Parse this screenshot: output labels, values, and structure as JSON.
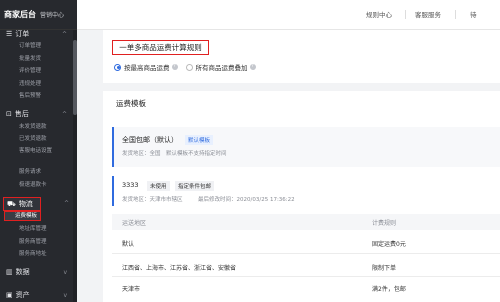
{
  "brand": {
    "title": "商家后台",
    "subtitle": "营销中心"
  },
  "topbar": {
    "links": [
      "规则中心",
      "客服服务",
      "待"
    ]
  },
  "sidebar": {
    "groups": [
      {
        "label": "订单",
        "items": [
          "订单管理",
          "批量发货",
          "评价管理",
          "违规处理",
          "售后预警"
        ]
      },
      {
        "label": "售后",
        "items": [
          "未发货退款",
          "已发货退款",
          "客服电话设置",
          "服务请求",
          "极速退款卡"
        ]
      },
      {
        "label": "物流",
        "items": [
          "运费模板",
          "地址库管理",
          "服务商管理",
          "服务商地址"
        ]
      },
      {
        "label": "数据",
        "items": []
      },
      {
        "label": "资产",
        "items": []
      }
    ]
  },
  "main": {
    "title": "一单多商品运费计算规则",
    "options": [
      {
        "label": "按最高商品运费",
        "selected": true
      },
      {
        "label": "所有商品运费叠加",
        "selected": false
      }
    ],
    "section_title": "运费模板",
    "template1": {
      "name": "全国包邮（默认）",
      "badge": "默认模板",
      "area": "发货地区：全国　默认模板不支持指定时间"
    },
    "template2": {
      "name": "3333",
      "tags": [
        "未使用",
        "指定条件包邮"
      ],
      "area": "发货地区：天津市市辖区",
      "time": "最后修改时间：2020/03/25 17:36:22"
    },
    "table": {
      "headers": [
        "运送地区",
        "计费规则"
      ],
      "rows": [
        {
          "region": "默认",
          "rule": "固定运费0元"
        },
        {
          "region": "江西省、上海市、江苏省、浙江省、安徽省",
          "rule": "限制下单"
        },
        {
          "region": "天津市",
          "rule": "满2件，包邮"
        }
      ]
    }
  },
  "colors": {
    "accent": "#2f6bdf",
    "highlight": "#e02020",
    "sidebar_bg": "#27292e"
  }
}
